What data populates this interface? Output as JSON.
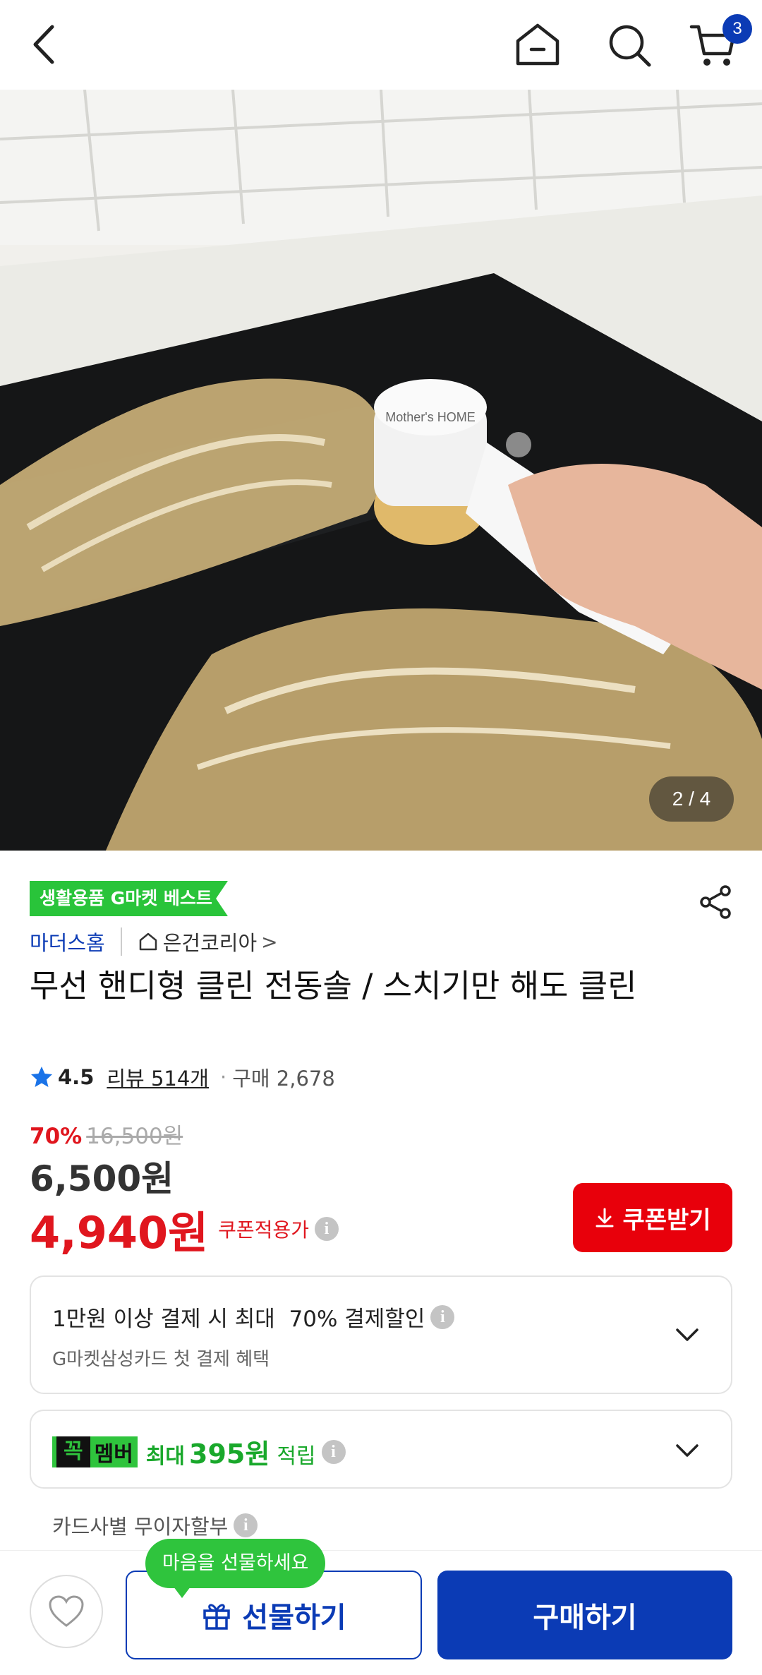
{
  "header": {
    "back_icon": "chevron-left-icon",
    "home_icon": "home-icon",
    "search_icon": "search-icon",
    "cart_icon": "cart-icon",
    "cart_count": "3"
  },
  "gallery": {
    "pager": "2 / 4"
  },
  "product": {
    "best_badge": "생활용품 G마켓 베스트",
    "seller_brand": "마더스홈",
    "shop_name": "은건코리아",
    "shop_arrow": ">",
    "title": "무선 핸디형 클린 전동솔 / 스치기만 해도 클린",
    "rating": "4.5",
    "review_label": "리뷰 514개",
    "purchase_label": "구매 2,678",
    "discount_rate": "70%",
    "original_price": "16,500원",
    "sale_price": "6,500원",
    "coupon_price": "4,940원",
    "coupon_price_label": "쿠폰적용가",
    "coupon_button": "쿠폰받기"
  },
  "benefits": {
    "card_main": "1만원 이상 결제 시 최대  70% 결제할인",
    "card_sub": "G마켓삼성카드 첫 결제 혜택",
    "member_logo_k": "꼭",
    "member_logo_m": "멤버",
    "member_prefix": "최대",
    "member_amount": "395원",
    "member_suffix": "적립",
    "installment": "카드사별 무이자할부"
  },
  "bottom": {
    "gift_tooltip": "마음을 선물하세요",
    "gift_button": "선물하기",
    "buy_button": "구매하기"
  },
  "colors": {
    "brand_blue": "#0b3bb5",
    "sale_red": "#e0161e",
    "member_green": "#2fc43d"
  }
}
